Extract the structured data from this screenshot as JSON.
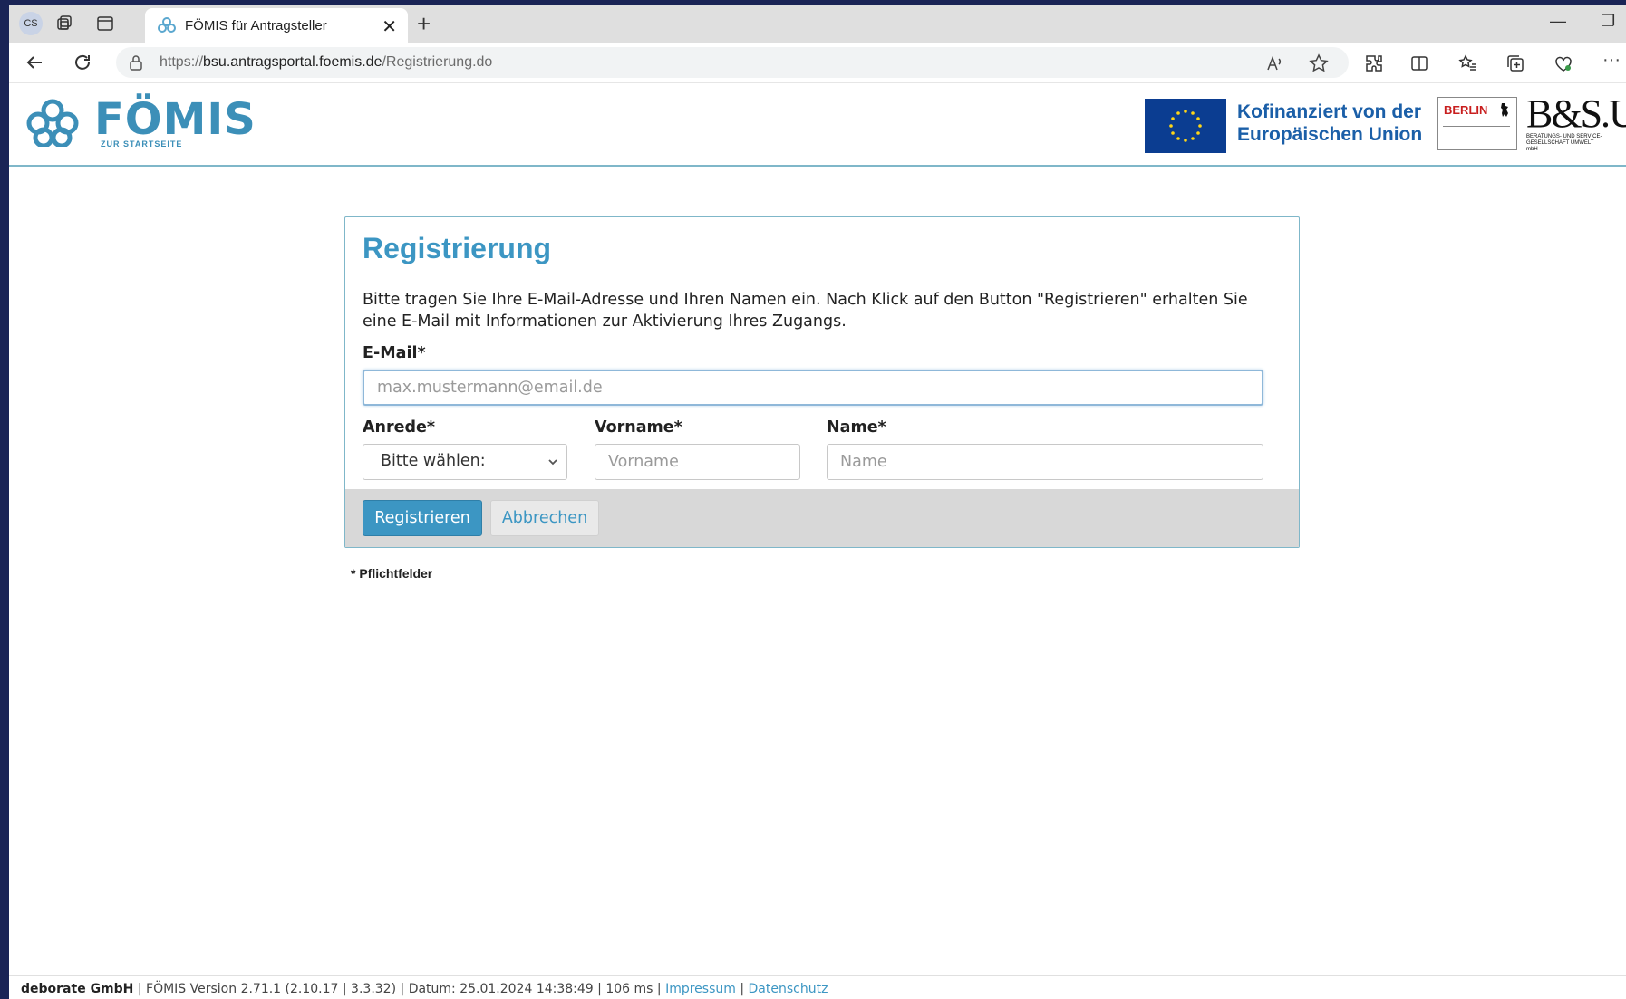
{
  "browser": {
    "profile_initials": "CS",
    "tab_title": "FÖMIS für Antragsteller",
    "url_prefix": "https://",
    "url_host": "bsu.antragsportal.foemis.de",
    "url_path": "/Registrierung.do"
  },
  "header": {
    "logo_name": "FÖMIS",
    "logo_sub": "ZUR STARTSEITE",
    "eu_line1": "Kofinanziert von der",
    "eu_line2": "Europäischen Union",
    "berlin_label": "BERLIN",
    "bsu_label": "B&S.U.",
    "bsu_sub": "BERATUNGS- UND SERVICE-GESELLSCHAFT UMWELT mbH"
  },
  "form": {
    "title": "Registrierung",
    "intro": "Bitte tragen Sie Ihre E-Mail-Adresse und Ihren Namen ein. Nach Klick auf den Button \"Registrieren\" erhalten Sie eine E-Mail mit Informationen zur Aktivierung Ihres Zugangs.",
    "email_label": "E-Mail*",
    "email_placeholder": "max.mustermann@email.de",
    "anrede_label": "Anrede*",
    "anrede_value": "Bitte wählen:",
    "vorname_label": "Vorname*",
    "vorname_placeholder": "Vorname",
    "name_label": "Name*",
    "name_placeholder": "Name",
    "submit_label": "Registrieren",
    "cancel_label": "Abbrechen",
    "required_note": "* Pflichtfelder"
  },
  "footer": {
    "company": "deborate GmbH",
    "version": "FÖMIS Version 2.71.1 (2.10.17 | 3.3.32)",
    "date": "Datum: 25.01.2024 14:38:49",
    "timing": "106 ms",
    "impressum": "Impressum",
    "datenschutz": "Datenschutz"
  },
  "colors": {
    "accent": "#3c96c3",
    "eu_blue": "#0b3d91",
    "backdrop": "#1a2456"
  }
}
